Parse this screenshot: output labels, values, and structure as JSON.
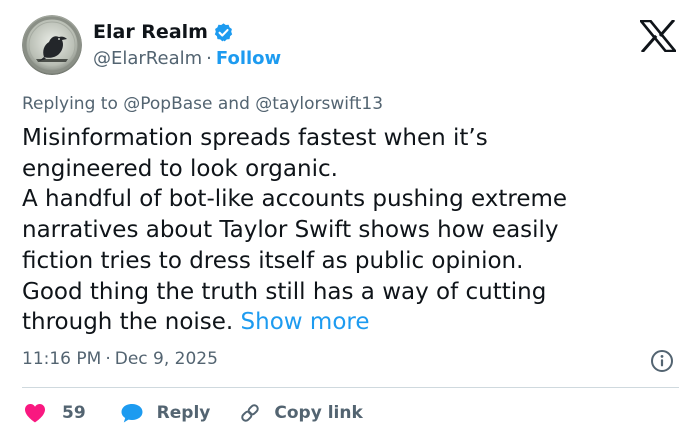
{
  "author": {
    "name": "Elar Realm",
    "handle": "@ElarRealm",
    "separator": "·",
    "follow_label": "Follow"
  },
  "reply_context": {
    "prefix": "Replying to",
    "mention1": "@PopBase",
    "conjunction": "and",
    "mention2": "@taylorswift13"
  },
  "post": {
    "lines": [
      "Misinformation spreads fastest when it’s",
      "engineered to look organic.",
      "A handful of bot-like accounts pushing extreme",
      "narratives about Taylor Swift shows how easily",
      "fiction tries to dress itself as public opinion.",
      "Good thing the truth still has a way of cutting",
      "through the noise."
    ],
    "show_more": "Show more"
  },
  "meta": {
    "time": "11:16 PM",
    "separator": "·",
    "date": "Dec 9, 2025"
  },
  "actions": {
    "like_count": "59",
    "reply_label": "Reply",
    "copy_label": "Copy link"
  },
  "colors": {
    "accent": "#1d9bf0",
    "like": "#f91880",
    "secondary_text": "#536471",
    "primary_text": "#0f1419"
  },
  "icons": [
    "verified-badge-icon",
    "x-logo-icon",
    "info-icon",
    "heart-icon",
    "reply-bubble-icon",
    "link-icon"
  ]
}
